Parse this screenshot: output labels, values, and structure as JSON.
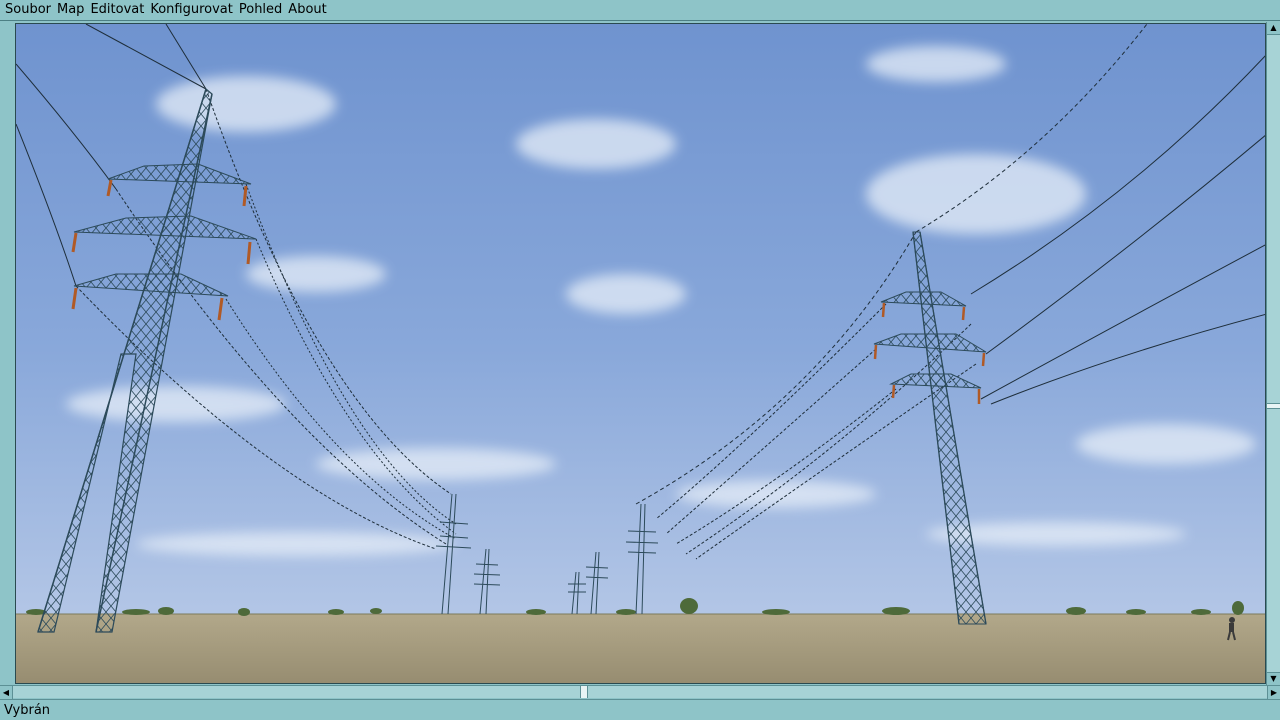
{
  "menubar": {
    "items": [
      {
        "label": "Soubor"
      },
      {
        "label": "Map"
      },
      {
        "label": "Editovat"
      },
      {
        "label": "Konfigurovat"
      },
      {
        "label": "Pohled"
      },
      {
        "label": "About"
      }
    ]
  },
  "viewport": {
    "description_icon": "3d-scene",
    "sky_top_color": "#6f93cf",
    "sky_horizon_color": "#b3c6e6",
    "ground_color": "#a79e80",
    "tower_color": "#2c4a5a",
    "insulator_color": "#b05a26"
  },
  "scrollbars": {
    "up_icon": "▲",
    "down_icon": "▼",
    "left_icon": "◀",
    "right_icon": "▶"
  },
  "status": {
    "text": "Vybrán"
  }
}
